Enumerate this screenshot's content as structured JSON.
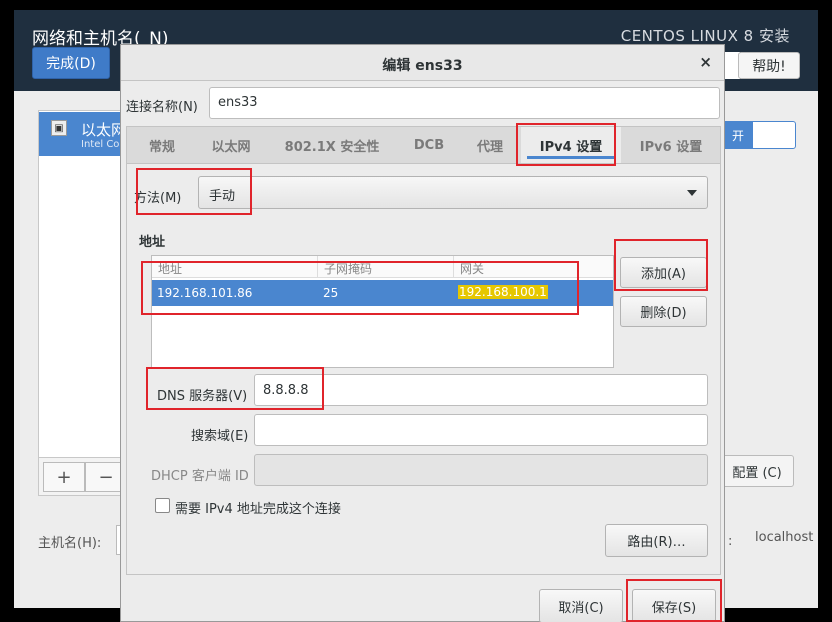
{
  "installer": {
    "title": "网络和主机名(_N)",
    "brand": "CENTOS LINUX 8 安装",
    "done_label": "完成(D)",
    "help_label": "帮助!",
    "device": {
      "name": "以太网",
      "sub": "Intel Corp"
    },
    "add_symbol": "+",
    "remove_symbol": "−",
    "toggle_label": "开",
    "config_label": "配置 (C)",
    "hostname_label": "主机名(H):",
    "current_hostname_colon": ":",
    "current_hostname": "localhost"
  },
  "dialog": {
    "title": "编辑 ens33",
    "close_symbol": "×",
    "connection_name_label": "连接名称(N)",
    "connection_name_value": "ens33",
    "tabs": [
      {
        "label": "常规"
      },
      {
        "label": "以太网"
      },
      {
        "label": "802.1X 安全性"
      },
      {
        "label": "DCB"
      },
      {
        "label": "代理"
      },
      {
        "label": "IPv4 设置"
      },
      {
        "label": "IPv6 设置"
      }
    ],
    "active_tab": "IPv4 设置",
    "method_label": "方法(M)",
    "method_value": "手动",
    "address_section": "地址",
    "address_columns": [
      "地址",
      "子网掩码",
      "网关"
    ],
    "address_rows": [
      {
        "address": "192.168.101.86",
        "netmask": "25",
        "gateway": "192.168.100.1"
      }
    ],
    "add_label": "添加(A)",
    "delete_label": "删除(D)",
    "dns_label": "DNS 服务器(V)",
    "dns_value": "8.8.8.8",
    "search_label": "搜索域(E)",
    "search_value": "",
    "dhcp_label": "DHCP 客户端 ID",
    "dhcp_value": "",
    "require_ipv4_label": "需要 IPv4 地址完成这个连接",
    "route_label": "路由(R)…",
    "cancel_label": "取消(C)",
    "save_label": "保存(S)"
  },
  "colors": {
    "accent": "#4a86cf",
    "header": "#1f2f3f",
    "annotation": "#e0242b",
    "highlight": "#e6c700"
  }
}
